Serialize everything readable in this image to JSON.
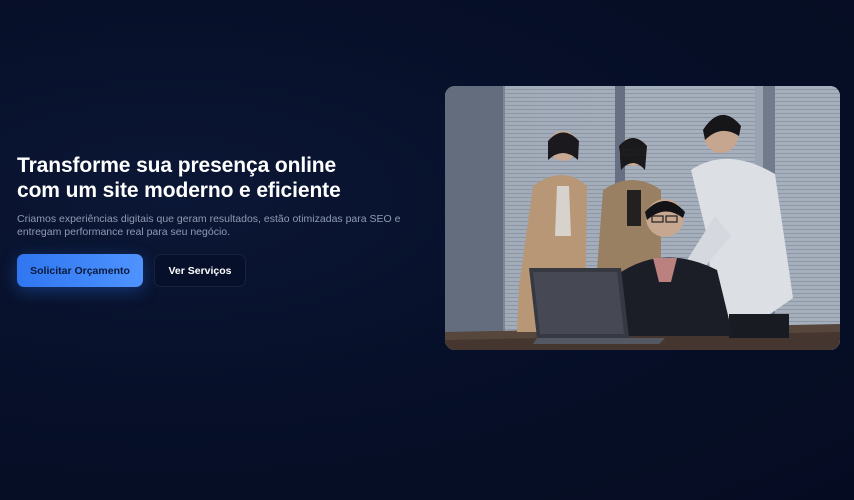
{
  "hero": {
    "title_line1": "Transforme sua presença online",
    "title_line2": "com um site moderno e eficiente",
    "subtitle_line1": "Criamos experiências digitais que geram resultados, estão otimizadas para SEO e",
    "subtitle_line2": "entregam performance real para seu negócio.",
    "primary_button": "Solicitar Orçamento",
    "secondary_button": "Ver Serviços"
  },
  "image": {
    "semantic": "team-meeting-laptop-photo"
  },
  "colors": {
    "background": "#071029",
    "accent": "#3b82f6",
    "text_primary": "#ffffff",
    "text_muted": "#8f9bb3"
  }
}
